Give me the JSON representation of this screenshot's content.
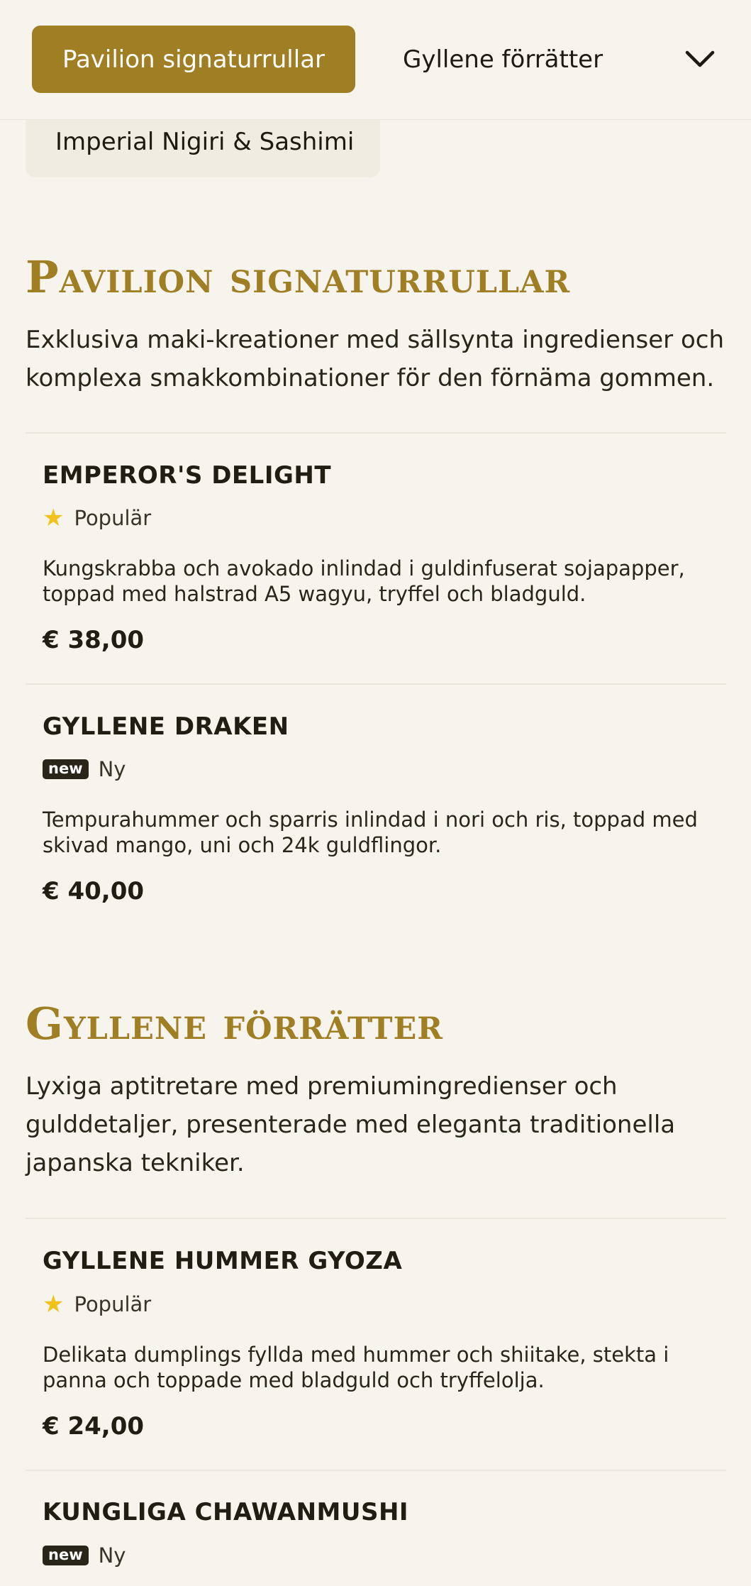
{
  "category_nav": {
    "active_tab": "Pavilion signaturrullar",
    "next_tab": "Gyllene förrätter",
    "hidden_tab": "Imperial Nigiri & Sashimi",
    "expand_icon": "chevron-down-icon"
  },
  "sections": [
    {
      "title": "Pavilion signaturrullar",
      "description": "Exklusiva maki-kreationer med sällsynta ingredienser och komplexa smakkombinationer för den förnäma gommen.",
      "items": [
        {
          "name": "EMPEROR'S DELIGHT",
          "badge_icon": "star-icon",
          "badge": "Populär",
          "description": "Kungskrabba och avokado inlindad i guldinfuserat sojapapper, toppad med halstrad A5 wagyu, tryffel och bladguld.",
          "price": "€ 38,00"
        },
        {
          "name": "GYLLENE DRAKEN",
          "badge_icon": "new-icon",
          "badge_icon_text": "new",
          "badge": "Ny",
          "description": "Tempurahummer och sparris inlindad i nori och ris, toppad med skivad mango, uni och 24k guldflingor.",
          "price": "€ 40,00"
        }
      ]
    },
    {
      "title": "Gyllene förrätter",
      "description": "Lyxiga aptitretare med premiumingredienser och gulddetaljer, presenterade med eleganta traditionella japanska tekniker.",
      "items": [
        {
          "name": "GYLLENE HUMMER GYOZA",
          "badge_icon": "star-icon",
          "badge": "Populär",
          "description": "Delikata dumplings fyllda med hummer och shiitake, stekta i panna och toppade med bladguld och tryffelolja.",
          "price": "€ 24,00"
        },
        {
          "name": "KUNGLIGA CHAWANMUSHI",
          "badge_icon": "new-icon",
          "badge_icon_text": "new",
          "badge": "Ny"
        }
      ]
    }
  ],
  "colors": {
    "accent_gold": "#a07e23",
    "background": "#f7f4ee",
    "star": "#f2c21b",
    "text": "#2a2519"
  }
}
